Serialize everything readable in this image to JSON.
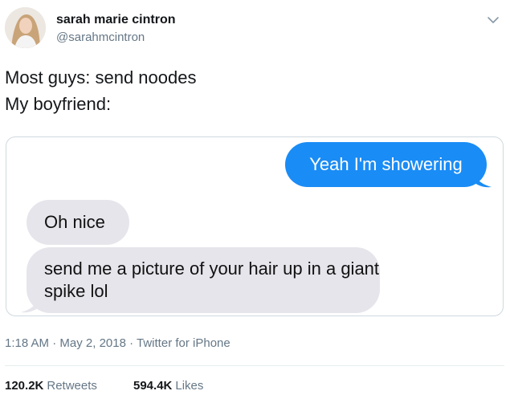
{
  "tweet": {
    "display_name": "sarah marie cintron",
    "handle": "@sarahmcintron",
    "text_line1": "Most guys: send noodes",
    "text_line2": "My boyfriend:",
    "time": "1:18 AM",
    "sep1": " · ",
    "date": "May 2, 2018",
    "sep2": " · ",
    "source": "Twitter for iPhone",
    "retweets_count": "120.2K",
    "retweets_label": "Retweets",
    "likes_count": "594.4K",
    "likes_label": "Likes",
    "menu_icon": "chevron-down-icon",
    "avatar_icon": "avatar"
  },
  "conversation": {
    "sent_message": "Yeah I'm showering",
    "received_message_1": "Oh nice",
    "received_message_2": "send me a picture of your hair up in a giant spike lol",
    "sent_color": "#1a8cf5",
    "received_color": "#e6e5eb"
  }
}
